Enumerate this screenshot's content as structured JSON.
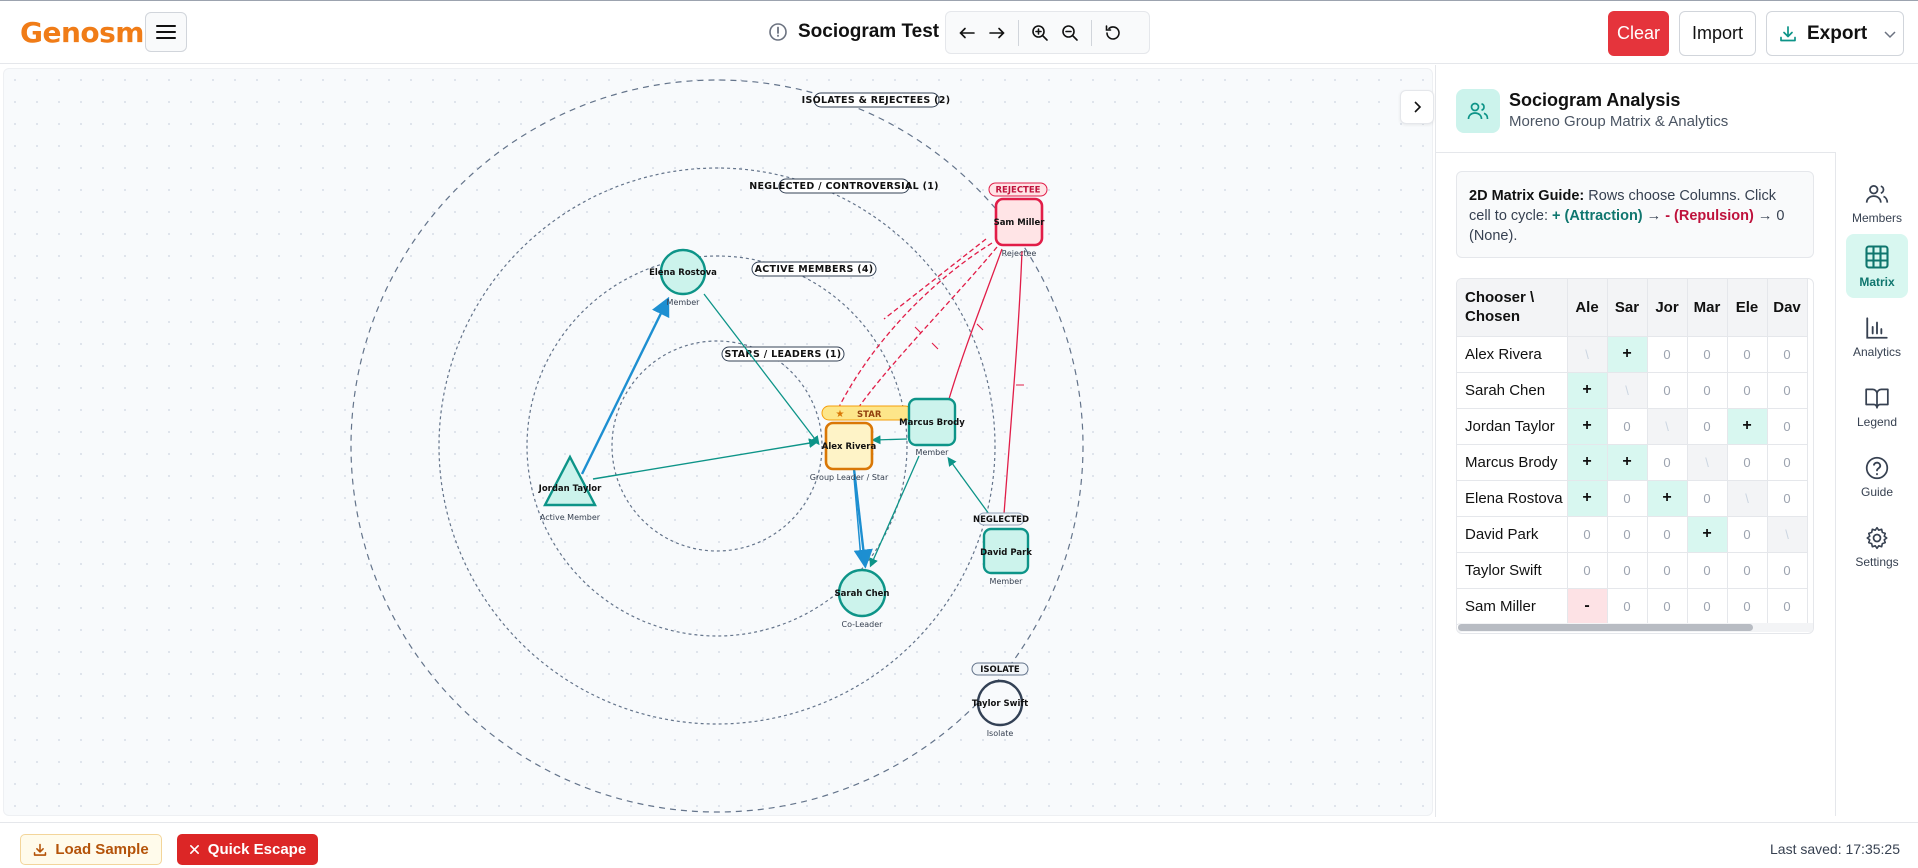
{
  "app": {
    "logo": "Genosm",
    "title": "Sociogram Test"
  },
  "header": {
    "clear_label": "Clear",
    "import_label": "Import",
    "export_label": "Export"
  },
  "canvas": {
    "rings": [
      {
        "label": "ISOLATES & REJECTEES (2)"
      },
      {
        "label": "NEGLECTED / CONTROVERSIAL (1)"
      },
      {
        "label": "ACTIVE MEMBERS (4)"
      },
      {
        "label": "STARS / LEADERS (1)"
      }
    ],
    "nodes": [
      {
        "id": "alex",
        "name": "Alex Rivera",
        "role": "Group Leader / Star",
        "badge": "STAR"
      },
      {
        "id": "sarah",
        "name": "Sarah Chen",
        "role": "Co-Leader",
        "badge": ""
      },
      {
        "id": "jordan",
        "name": "Jordan Taylor",
        "role": "Active Member",
        "badge": ""
      },
      {
        "id": "marcus",
        "name": "Marcus Brody",
        "role": "Member",
        "badge": ""
      },
      {
        "id": "elena",
        "name": "Elena Rostova",
        "role": "Member",
        "badge": ""
      },
      {
        "id": "david",
        "name": "David Park",
        "role": "Member",
        "badge": "NEGLECTED"
      },
      {
        "id": "taylor",
        "name": "Taylor Swift",
        "role": "Isolate",
        "badge": "ISOLATE"
      },
      {
        "id": "sam",
        "name": "Sam Miller",
        "role": "Rejectee",
        "badge": "REJECTEE"
      }
    ]
  },
  "panel": {
    "title": "Sociogram Analysis",
    "subtitle": "Moreno Group Matrix & Analytics",
    "guide": {
      "lead": "2D Matrix Guide:",
      "text1": " Rows choose Columns. Click cell to cycle: ",
      "attraction": "+ (Attraction)",
      "arrow1": " → ",
      "repulsion": "- (Repulsion)",
      "text2": " → 0 (None)."
    },
    "matrix": {
      "corner": "Chooser \\ Chosen",
      "columns": [
        "Ale",
        "Sar",
        "Jor",
        "Mar",
        "Ele",
        "Dav"
      ],
      "rows": [
        {
          "name": "Alex Rivera",
          "cells": [
            "\\",
            "+",
            "0",
            "0",
            "0",
            "0"
          ]
        },
        {
          "name": "Sarah Chen",
          "cells": [
            "+",
            "\\",
            "0",
            "0",
            "0",
            "0"
          ]
        },
        {
          "name": "Jordan Taylor",
          "cells": [
            "+",
            "0",
            "\\",
            "0",
            "+",
            "0"
          ]
        },
        {
          "name": "Marcus Brody",
          "cells": [
            "+",
            "+",
            "0",
            "\\",
            "0",
            "0"
          ]
        },
        {
          "name": "Elena Rostova",
          "cells": [
            "+",
            "0",
            "+",
            "0",
            "\\",
            "0"
          ]
        },
        {
          "name": "David Park",
          "cells": [
            "0",
            "0",
            "0",
            "+",
            "0",
            "\\"
          ]
        },
        {
          "name": "Taylor Swift",
          "cells": [
            "0",
            "0",
            "0",
            "0",
            "0",
            "0"
          ]
        },
        {
          "name": "Sam Miller",
          "cells": [
            "-",
            "0",
            "0",
            "0",
            "0",
            "0"
          ]
        }
      ]
    }
  },
  "side_tabs": [
    {
      "label": "Members",
      "icon": "users-icon"
    },
    {
      "label": "Matrix",
      "icon": "grid-icon",
      "active": true
    },
    {
      "label": "Analytics",
      "icon": "bar-chart-icon"
    },
    {
      "label": "Legend",
      "icon": "book-icon"
    },
    {
      "label": "Guide",
      "icon": "help-circle-icon"
    },
    {
      "label": "Settings",
      "icon": "gear-icon"
    }
  ],
  "footer": {
    "load_sample": "Load Sample",
    "quick_escape": "Quick Escape",
    "last_saved": "Last saved: 17:35:25"
  },
  "colors": {
    "brand": "#f07c17",
    "teal": "#0d9488",
    "attraction_blue": "#1d8fd1",
    "rejection": "#e11d48",
    "star": "#f59e0b"
  }
}
